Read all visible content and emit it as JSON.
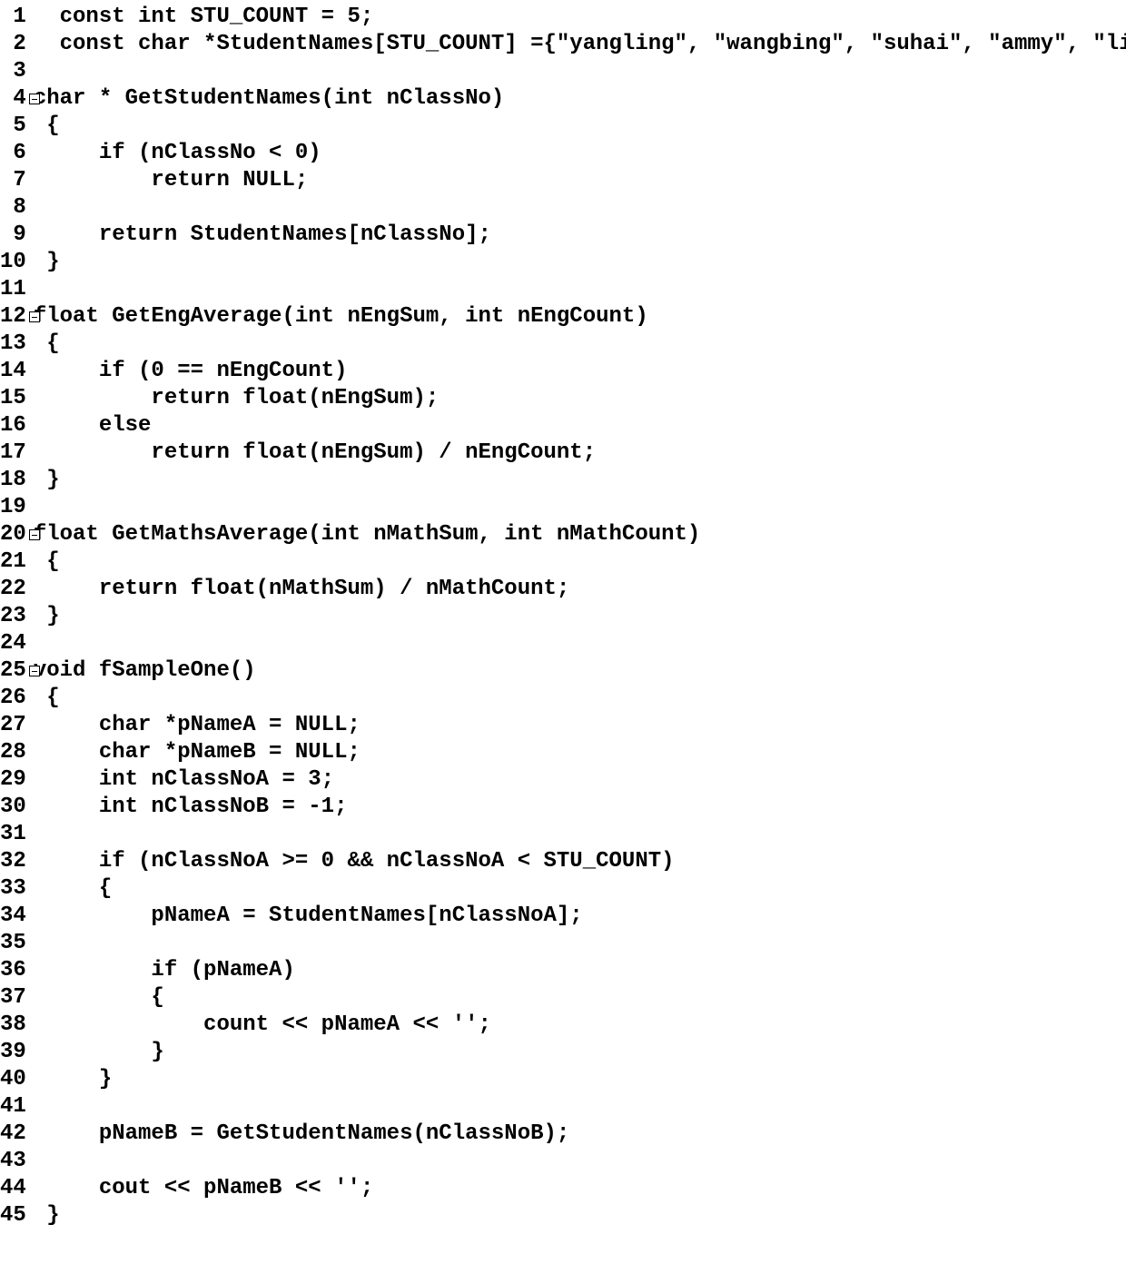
{
  "lines": [
    {
      "n": 1,
      "fold": "",
      "code": "  const int STU_COUNT = 5;"
    },
    {
      "n": 2,
      "fold": "",
      "code": "  const char *StudentNames[STU_COUNT] ={\"yangling\", \"wangbing\", \"suhai\", \"ammy\", \"lily\"};"
    },
    {
      "n": 3,
      "fold": "",
      "code": ""
    },
    {
      "n": 4,
      "fold": "-",
      "code": "char * GetStudentNames(int nClassNo)"
    },
    {
      "n": 5,
      "fold": "",
      "code": " {"
    },
    {
      "n": 6,
      "fold": "",
      "code": "     if (nClassNo < 0)"
    },
    {
      "n": 7,
      "fold": "",
      "code": "         return NULL;"
    },
    {
      "n": 8,
      "fold": "",
      "code": ""
    },
    {
      "n": 9,
      "fold": "",
      "code": "     return StudentNames[nClassNo];"
    },
    {
      "n": 10,
      "fold": "",
      "code": " }"
    },
    {
      "n": 11,
      "fold": "",
      "code": ""
    },
    {
      "n": 12,
      "fold": "-",
      "code": "float GetEngAverage(int nEngSum, int nEngCount)"
    },
    {
      "n": 13,
      "fold": "",
      "code": " {"
    },
    {
      "n": 14,
      "fold": "",
      "code": "     if (0 == nEngCount)"
    },
    {
      "n": 15,
      "fold": "",
      "code": "         return float(nEngSum);"
    },
    {
      "n": 16,
      "fold": "",
      "code": "     else"
    },
    {
      "n": 17,
      "fold": "",
      "code": "         return float(nEngSum) / nEngCount;"
    },
    {
      "n": 18,
      "fold": "",
      "code": " }"
    },
    {
      "n": 19,
      "fold": "",
      "code": ""
    },
    {
      "n": 20,
      "fold": "-",
      "code": "float GetMathsAverage(int nMathSum, int nMathCount)"
    },
    {
      "n": 21,
      "fold": "",
      "code": " {"
    },
    {
      "n": 22,
      "fold": "",
      "code": "     return float(nMathSum) / nMathCount;"
    },
    {
      "n": 23,
      "fold": "",
      "code": " }"
    },
    {
      "n": 24,
      "fold": "",
      "code": ""
    },
    {
      "n": 25,
      "fold": "-",
      "code": "void fSampleOne()"
    },
    {
      "n": 26,
      "fold": "",
      "code": " {"
    },
    {
      "n": 27,
      "fold": "",
      "code": "     char *pNameA = NULL;"
    },
    {
      "n": 28,
      "fold": "",
      "code": "     char *pNameB = NULL;"
    },
    {
      "n": 29,
      "fold": "",
      "code": "     int nClassNoA = 3;"
    },
    {
      "n": 30,
      "fold": "",
      "code": "     int nClassNoB = -1;"
    },
    {
      "n": 31,
      "fold": "",
      "code": ""
    },
    {
      "n": 32,
      "fold": "",
      "code": "     if (nClassNoA >= 0 && nClassNoA < STU_COUNT)"
    },
    {
      "n": 33,
      "fold": "",
      "code": "     {"
    },
    {
      "n": 34,
      "fold": "",
      "code": "         pNameA = StudentNames[nClassNoA];"
    },
    {
      "n": 35,
      "fold": "",
      "code": ""
    },
    {
      "n": 36,
      "fold": "",
      "code": "         if (pNameA)"
    },
    {
      "n": 37,
      "fold": "",
      "code": "         {"
    },
    {
      "n": 38,
      "fold": "",
      "code": "             count << pNameA << '';"
    },
    {
      "n": 39,
      "fold": "",
      "code": "         }"
    },
    {
      "n": 40,
      "fold": "",
      "code": "     }"
    },
    {
      "n": 41,
      "fold": "",
      "code": ""
    },
    {
      "n": 42,
      "fold": "",
      "code": "     pNameB = GetStudentNames(nClassNoB);"
    },
    {
      "n": 43,
      "fold": "",
      "code": ""
    },
    {
      "n": 44,
      "fold": "",
      "code": "     cout << pNameB << '';"
    },
    {
      "n": 45,
      "fold": "",
      "code": " }"
    }
  ]
}
